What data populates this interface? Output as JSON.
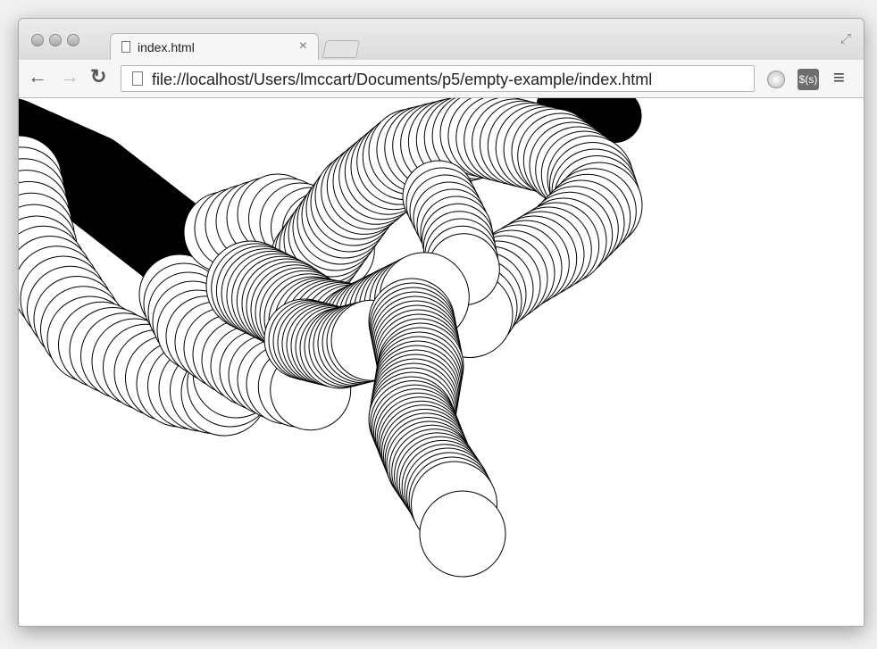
{
  "tab": {
    "title": "index.html",
    "close_glyph": "×"
  },
  "toolbar": {
    "url": "file://localhost/Users/lmccart/Documents/p5/empty-example/index.html",
    "back_glyph": "←",
    "forward_glyph": "→",
    "reload_glyph": "↻",
    "menu_glyph": "≡",
    "extension_label": "$(s)"
  },
  "icons": {
    "window_buttons": [
      "close-icon",
      "minimize-icon",
      "zoom-icon"
    ],
    "page": "page-icon",
    "fullscreen": "fullscreen-icon",
    "extension": "globe-icon",
    "menu": "hamburger-menu-icon"
  },
  "colors": {
    "stroke": "#000000",
    "fill": "#ffffff"
  }
}
